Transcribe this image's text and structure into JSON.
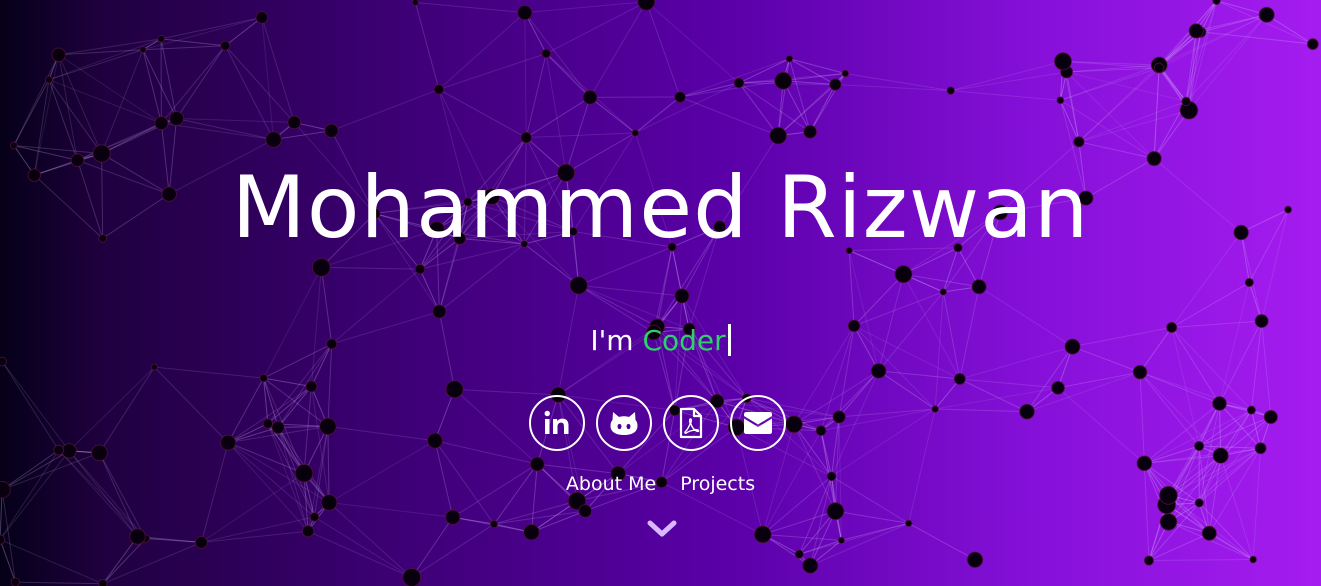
{
  "hero": {
    "title": "Mohammed Rizwan",
    "intro_prefix": "I'm ",
    "intro_role": "Coder"
  },
  "socials": [
    {
      "name": "linkedin",
      "icon": "linkedin-icon"
    },
    {
      "name": "github",
      "icon": "github-icon"
    },
    {
      "name": "resume",
      "icon": "pdf-icon"
    },
    {
      "name": "email",
      "icon": "envelope-icon"
    }
  ],
  "nav": {
    "about_label": "About Me",
    "projects_label": "Projects"
  },
  "scroll": {
    "icon": "chevron-down-icon"
  },
  "colors": {
    "role": "#2fd06a",
    "gradient_start": "#050018",
    "gradient_end": "#a51cf0"
  }
}
